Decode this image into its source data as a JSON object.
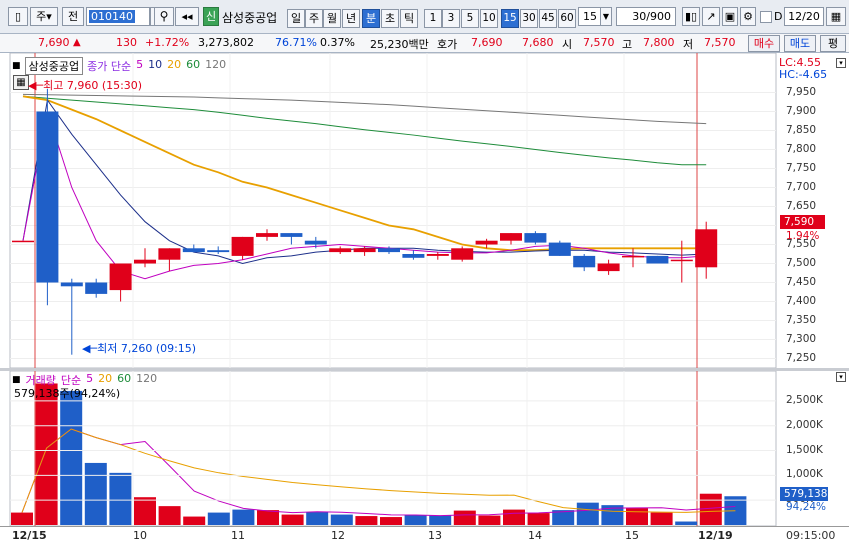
{
  "toolbar": {
    "period_main": "주",
    "prev": "전",
    "code": "010140",
    "new_badge": "신",
    "stock_name": "삼성중공업",
    "periods": [
      "일",
      "주",
      "월",
      "년",
      "분",
      "초",
      "틱"
    ],
    "active_period": "분",
    "minutes": [
      "1",
      "3",
      "5",
      "10",
      "15",
      "30",
      "45",
      "60"
    ],
    "active_minute": "15",
    "interval_select": "15",
    "count_display": "30/900",
    "checkbox_label": "D",
    "date_value": "12/20",
    "colors": {
      "active": "#2d6fd2",
      "up": "#e0001a",
      "down": "#0045d8"
    }
  },
  "quote": {
    "price": "7,690",
    "arrow": "▲",
    "change": "130",
    "change_rate": "+1.72%",
    "volume": "3,273,802",
    "vol_ratio": "76.71%",
    "turnover": "0.37%",
    "amount": "25,230백만",
    "label_hoga": "호가",
    "hoga1": "7,690",
    "hoga2": "7,680",
    "label_open": "시",
    "open": "7,570",
    "label_high": "고",
    "high": "7,800",
    "label_low": "저",
    "low": "7,570",
    "buy": "매수",
    "sell": "매도",
    "eval": "평"
  },
  "price_panel": {
    "title": "삼성중공업",
    "legend": [
      "종가 단순",
      "5",
      "10",
      "20",
      "60",
      "120"
    ],
    "legend_colors": [
      "#8a2be2",
      "#c000c0",
      "#1c2f8a",
      "#e8a000",
      "#1e8c3a",
      "#777777"
    ],
    "lc": "LC:4.55",
    "hc": "HC:-4.65",
    "high_marker": "최고 7,960 (15:30)",
    "low_marker": "최저 7,260 (09:15)",
    "current_price_tag": "7,590",
    "current_rate_tag": "1.94%",
    "yticks": [
      "7,950",
      "7,900",
      "7,850",
      "7,800",
      "7,750",
      "7,700",
      "7,650",
      "7,600",
      "7,550",
      "7,500",
      "7,450",
      "7,400",
      "7,350",
      "7,300",
      "7,250"
    ]
  },
  "volume_panel": {
    "title": "거래량",
    "legend": [
      "단순",
      "5",
      "20",
      "60",
      "120"
    ],
    "legend_colors": [
      "#c000c0",
      "#c000c0",
      "#e8a000",
      "#1e8c3a",
      "#777777"
    ],
    "info": "579,138주(94,24%)",
    "yticks": [
      "2,500K",
      "2,000K",
      "1,500K",
      "1,000K",
      "500K"
    ],
    "current_tag": "579,138",
    "rate_tag": "94,24%"
  },
  "xaxis": {
    "labels": [
      "12/15",
      "10",
      "11",
      "12",
      "13",
      "14",
      "15",
      "12/19"
    ],
    "time": "09:15:00"
  },
  "chart_data": {
    "type": "candlestick",
    "price_range": [
      7225,
      7975
    ],
    "candles": [
      {
        "o": 7560,
        "h": 7560,
        "l": 7560,
        "c": 7560
      },
      {
        "o": 7900,
        "h": 7960,
        "l": 7390,
        "c": 7450
      },
      {
        "o": 7450,
        "h": 7460,
        "l": 7260,
        "c": 7440
      },
      {
        "o": 7450,
        "h": 7460,
        "l": 7410,
        "c": 7420
      },
      {
        "o": 7430,
        "h": 7500,
        "l": 7400,
        "c": 7500
      },
      {
        "o": 7500,
        "h": 7540,
        "l": 7490,
        "c": 7510
      },
      {
        "o": 7510,
        "h": 7540,
        "l": 7480,
        "c": 7540
      },
      {
        "o": 7540,
        "h": 7550,
        "l": 7530,
        "c": 7530
      },
      {
        "o": 7535,
        "h": 7545,
        "l": 7525,
        "c": 7530
      },
      {
        "o": 7520,
        "h": 7570,
        "l": 7510,
        "c": 7570
      },
      {
        "o": 7570,
        "h": 7590,
        "l": 7560,
        "c": 7580
      },
      {
        "o": 7580,
        "h": 7580,
        "l": 7550,
        "c": 7570
      },
      {
        "o": 7560,
        "h": 7570,
        "l": 7540,
        "c": 7550
      },
      {
        "o": 7530,
        "h": 7545,
        "l": 7525,
        "c": 7540
      },
      {
        "o": 7530,
        "h": 7545,
        "l": 7520,
        "c": 7540
      },
      {
        "o": 7540,
        "h": 7545,
        "l": 7525,
        "c": 7530
      },
      {
        "o": 7525,
        "h": 7535,
        "l": 7510,
        "c": 7515
      },
      {
        "o": 7520,
        "h": 7530,
        "l": 7510,
        "c": 7525
      },
      {
        "o": 7510,
        "h": 7545,
        "l": 7505,
        "c": 7540
      },
      {
        "o": 7550,
        "h": 7565,
        "l": 7540,
        "c": 7560
      },
      {
        "o": 7560,
        "h": 7580,
        "l": 7550,
        "c": 7580
      },
      {
        "o": 7580,
        "h": 7585,
        "l": 7550,
        "c": 7555
      },
      {
        "o": 7555,
        "h": 7560,
        "l": 7520,
        "c": 7520
      },
      {
        "o": 7520,
        "h": 7525,
        "l": 7480,
        "c": 7490
      },
      {
        "o": 7480,
        "h": 7510,
        "l": 7470,
        "c": 7500
      },
      {
        "o": 7520,
        "h": 7540,
        "l": 7490,
        "c": 7520
      },
      {
        "o": 7520,
        "h": 7520,
        "l": 7500,
        "c": 7500
      },
      {
        "o": 7510,
        "h": 7560,
        "l": 7450,
        "c": 7510
      },
      {
        "o": 7490,
        "h": 7610,
        "l": 7460,
        "c": 7590
      }
    ],
    "ma5": [
      7560,
      7900,
      7700,
      7560,
      7480,
      7460,
      7480,
      7495,
      7500,
      7510,
      7525,
      7540,
      7545,
      7550,
      7545,
      7540,
      7535,
      7530,
      7528,
      7528,
      7535,
      7545,
      7548,
      7540,
      7528,
      7520,
      7515,
      7515,
      7520
    ],
    "ma10": [
      7560,
      7930,
      7840,
      7760,
      7680,
      7610,
      7560,
      7530,
      7520,
      7500,
      7515,
      7520,
      7530,
      7535,
      7540,
      7540,
      7540,
      7535,
      7532,
      7530,
      7530,
      7533,
      7535,
      7535,
      7530,
      7528,
      7525,
      7522,
      7525
    ],
    "ma20": [
      7940,
      7930,
      7905,
      7880,
      7850,
      7820,
      7790,
      7760,
      7740,
      7715,
      7700,
      7680,
      7660,
      7640,
      7620,
      7600,
      7590,
      7570,
      7550,
      7540,
      7535,
      7535,
      7538,
      7540,
      7540,
      7540,
      7540,
      7540,
      7540
    ],
    "ma60": [
      7940,
      7935,
      7930,
      7925,
      7920,
      7915,
      7910,
      7905,
      7898,
      7890,
      7882,
      7875,
      7868,
      7860,
      7852,
      7845,
      7838,
      7830,
      7822,
      7815,
      7808,
      7800,
      7792,
      7785,
      7778,
      7772,
      7765,
      7760,
      7760
    ],
    "ma120": [
      7945,
      7944,
      7943,
      7942,
      7941,
      7940,
      7939,
      7938,
      7936,
      7934,
      7932,
      7930,
      7927,
      7924,
      7921,
      7918,
      7914,
      7910,
      7906,
      7902,
      7898,
      7894,
      7890,
      7886,
      7882,
      7878,
      7874,
      7871,
      7868
    ],
    "volume_range": [
      0,
      2900000
    ],
    "volume": [
      250000,
      2850000,
      2700000,
      1250000,
      1050000,
      560000,
      380000,
      170000,
      250000,
      310000,
      300000,
      210000,
      260000,
      210000,
      180000,
      160000,
      200000,
      190000,
      290000,
      190000,
      310000,
      240000,
      300000,
      450000,
      400000,
      340000,
      250000,
      70000,
      630000,
      579138
    ]
  }
}
